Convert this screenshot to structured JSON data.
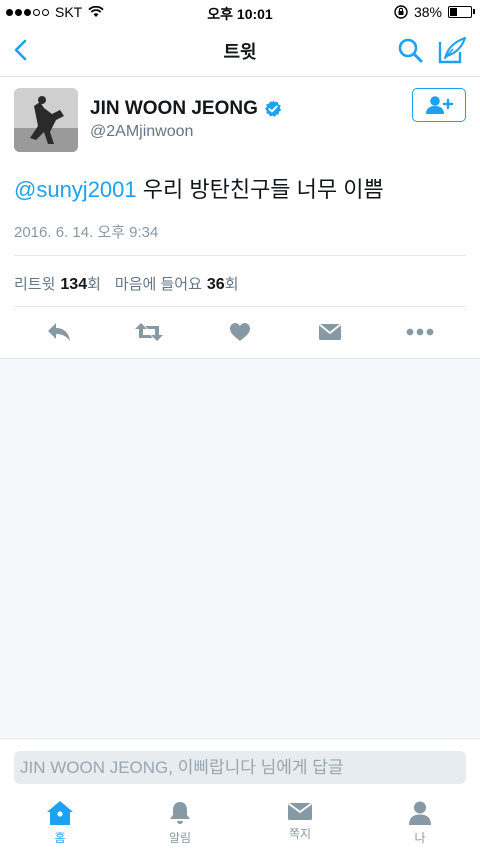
{
  "status_bar": {
    "carrier": "SKT",
    "time": "오후 10:01",
    "battery": "38%",
    "battery_level": 0.38
  },
  "nav": {
    "title": "트윗",
    "back_icon": "chevron-left-icon",
    "search_icon": "search-icon",
    "compose_icon": "compose-quill-icon"
  },
  "tweet": {
    "display_name": "JIN WOON JEONG",
    "verified": true,
    "handle": "@2AMjinwoon",
    "mention": "@sunyj2001",
    "text": " 우리 방탄친구들 너무 이쁨",
    "timestamp": "2016. 6. 14. 오후 9:34",
    "stats": {
      "retweet_label": "리트윗",
      "retweet_count": "134",
      "retweet_unit": "회",
      "like_label": "마음에 들어요",
      "like_count": "36",
      "like_unit": "회"
    }
  },
  "reply": {
    "placeholder": "JIN WOON JEONG, 이삐랍니다 님에게 답글"
  },
  "tabs": [
    {
      "label": "홈",
      "icon": "home-icon",
      "active": true
    },
    {
      "label": "알림",
      "icon": "bell-icon",
      "active": false
    },
    {
      "label": "쪽지",
      "icon": "envelope-icon",
      "active": false
    },
    {
      "label": "나",
      "icon": "person-icon",
      "active": false
    }
  ],
  "colors": {
    "accent": "#1da1f2",
    "icon_gray": "#8899a6",
    "timeline_bg": "#f5f8fa"
  }
}
